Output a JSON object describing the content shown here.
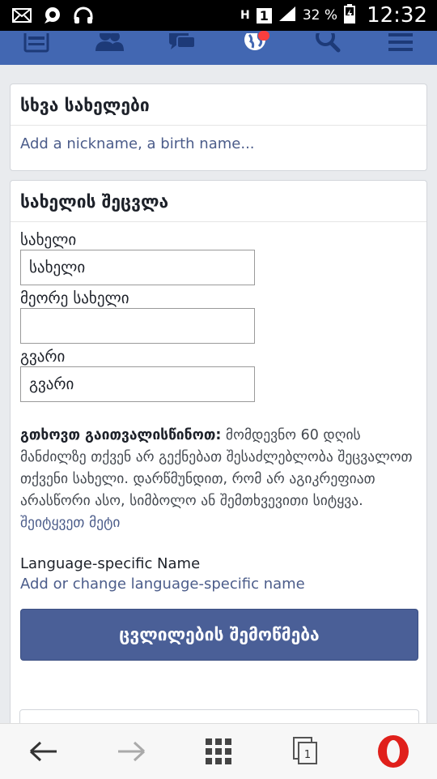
{
  "status_bar": {
    "battery": "32 %",
    "clock": "12:32",
    "network": "H",
    "sim": "1"
  },
  "icons": {
    "mail": "mail-icon",
    "chat": "chat-bubble-icon",
    "headphones": "headphones-icon"
  },
  "other_names": {
    "title": "სხვა სახელები",
    "add_link": "Add a nickname, a birth name..."
  },
  "change_name": {
    "title": "სახელის შეცვლა",
    "first_name_label": "სახელი",
    "first_name_value": "სახელი",
    "middle_name_label": "მეორე სახელი",
    "middle_name_value": "",
    "last_name_label": "გვარი",
    "last_name_value": "გვარი",
    "note_bold": "გთხოვთ გაითვალისწინოთ:",
    "note_text": " მომდევნო 60 დღის მანძილზე თქვენ არ გექნებათ შესაძლებლობა შეცვალოთ თქვენი სახელი. დარწმუნდით, რომ არ აგიკრეფიათ არასწორი ასო, სიმბოლო ან შემთხვევითი სიტყვა.",
    "learn_more": "შეიტყვეთ მეტი",
    "language_title": "Language-specific Name",
    "language_link": "Add or change language-specific name",
    "submit_label": "ცვლილების შემოწმება"
  },
  "browser": {
    "tab_count": "1"
  },
  "colors": {
    "fb_blue": "#4267b2",
    "button": "#4a5f97",
    "link": "#4b5c8a",
    "badge": "#fa3e3e",
    "opera_red": "#e0201b"
  }
}
